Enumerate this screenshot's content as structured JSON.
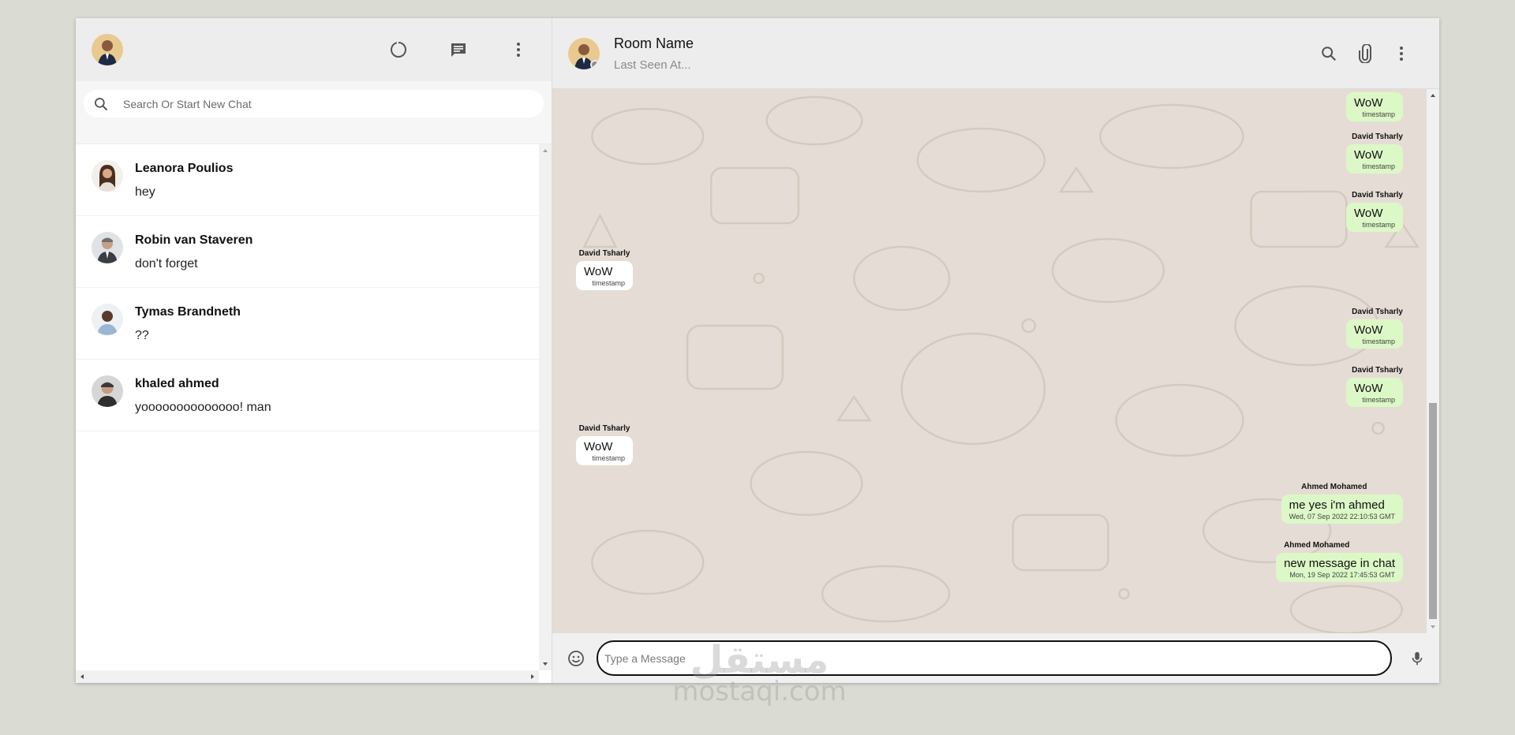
{
  "sidebar": {
    "search": {
      "placeholder": "Search Or Start New Chat"
    },
    "chats": [
      {
        "name": "Leanora Poulios",
        "last_message": "hey",
        "avatar_color": "#c9a88e"
      },
      {
        "name": "Robin van Staveren",
        "last_message": "don't forget",
        "avatar_color": "#9ea4aa"
      },
      {
        "name": "Tymas Brandneth",
        "last_message": "??",
        "avatar_color": "#b9b9b9"
      },
      {
        "name": "khaled ahmed",
        "last_message": "yoooooooooooooo! man",
        "avatar_color": "#8d8d8d"
      }
    ],
    "header_icons": [
      "status-icon",
      "new-chat-icon",
      "menu-icon"
    ]
  },
  "chat": {
    "room_name": "Room Name",
    "last_seen": "Last Seen At...",
    "header_icons": [
      "search-icon",
      "attach-icon",
      "menu-icon"
    ],
    "messages": [
      {
        "sender": "",
        "text": "WoW",
        "timestamp": "timestamp",
        "outgoing": true
      },
      {
        "sender": "David Tsharly",
        "text": "WoW",
        "timestamp": "timestamp",
        "outgoing": true
      },
      {
        "sender": "David Tsharly",
        "text": "WoW",
        "timestamp": "timestamp",
        "outgoing": true
      },
      {
        "sender": "David Tsharly",
        "text": "WoW",
        "timestamp": "timestamp",
        "outgoing": false
      },
      {
        "sender": "David Tsharly",
        "text": "WoW",
        "timestamp": "timestamp",
        "outgoing": true
      },
      {
        "sender": "David Tsharly",
        "text": "WoW",
        "timestamp": "timestamp",
        "outgoing": true
      },
      {
        "sender": "David Tsharly",
        "text": "WoW",
        "timestamp": "timestamp",
        "outgoing": false
      },
      {
        "sender": "Ahmed Mohamed",
        "text": "me yes i'm ahmed",
        "timestamp": "Wed, 07 Sep 2022 22:10:53 GMT",
        "outgoing": true
      },
      {
        "sender": "Ahmed Mohamed",
        "text": "new message in chat",
        "timestamp": "Mon, 19 Sep 2022 17:45:53 GMT",
        "outgoing": true
      }
    ],
    "input": {
      "placeholder": "Type a Message",
      "value": ""
    }
  },
  "watermark": {
    "arabic": "مستقل",
    "latin": "mostaqi.com"
  },
  "colors": {
    "outgoing_bubble": "#dcf8c6",
    "incoming_bubble": "#ffffff",
    "header_bg": "#ededed",
    "chat_bg": "#e5ddd5"
  }
}
